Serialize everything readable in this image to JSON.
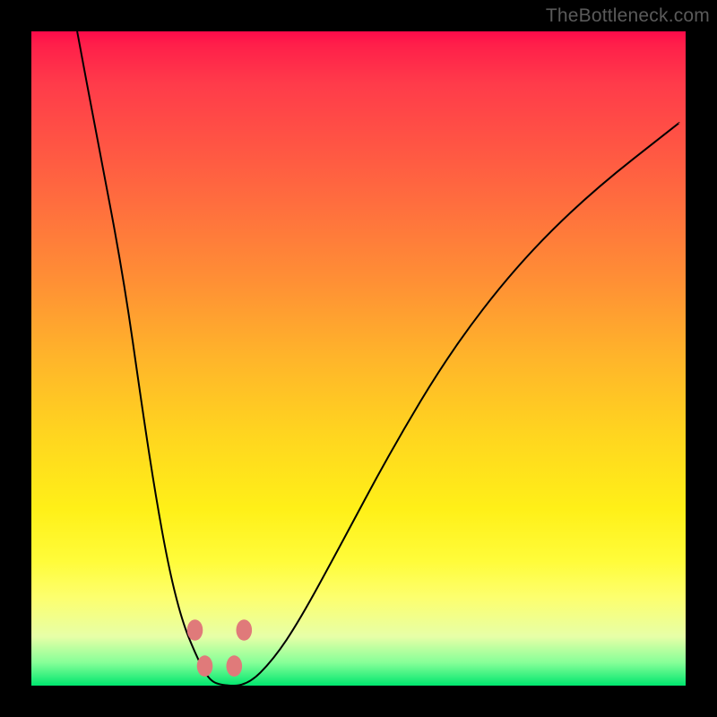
{
  "brand": {
    "watermark": "TheBottleneck.com"
  },
  "background": {
    "gradient_stops": [
      {
        "offset": 0,
        "color": "#ff0a4a"
      },
      {
        "offset": 0.08,
        "color": "#ff3b4a"
      },
      {
        "offset": 0.25,
        "color": "#ff6a3f"
      },
      {
        "offset": 0.5,
        "color": "#ffb52a"
      },
      {
        "offset": 0.73,
        "color": "#fff018"
      },
      {
        "offset": 0.86,
        "color": "#fdff6e"
      },
      {
        "offset": 0.96,
        "color": "#86ff98"
      },
      {
        "offset": 1.0,
        "color": "#00e66e"
      }
    ]
  },
  "chart_data": {
    "type": "line",
    "title": "",
    "xlabel": "",
    "ylabel": "",
    "xlim": [
      0,
      100
    ],
    "ylim": [
      0,
      100
    ],
    "grid": false,
    "series": [
      {
        "name": "curve",
        "color": "#000000",
        "x": [
          7,
          10,
          14,
          17,
          19,
          21,
          23,
          25,
          27,
          29,
          33,
          37,
          41,
          47,
          55,
          64,
          74,
          85,
          99
        ],
        "y": [
          100,
          84,
          63,
          42,
          29,
          18,
          10,
          5,
          1,
          0,
          0,
          4,
          10,
          21,
          36,
          51,
          64,
          75,
          86
        ]
      }
    ],
    "markers": [
      {
        "x": 25.0,
        "y": 8.5,
        "color": "#e07a7a",
        "r": 1.2
      },
      {
        "x": 32.5,
        "y": 8.5,
        "color": "#e07a7a",
        "r": 1.2
      },
      {
        "x": 26.5,
        "y": 3.0,
        "color": "#e07a7a",
        "r": 1.2
      },
      {
        "x": 31.0,
        "y": 3.0,
        "color": "#e07a7a",
        "r": 1.2
      }
    ],
    "notes": "V-shaped curve on a vertical heat gradient (pink→green). Minimum of the curve sits near the green band at x≈29. No numeric axes are rendered; x and y are read as 0–100% of the plot area (x left→right, y bottom→top)."
  }
}
